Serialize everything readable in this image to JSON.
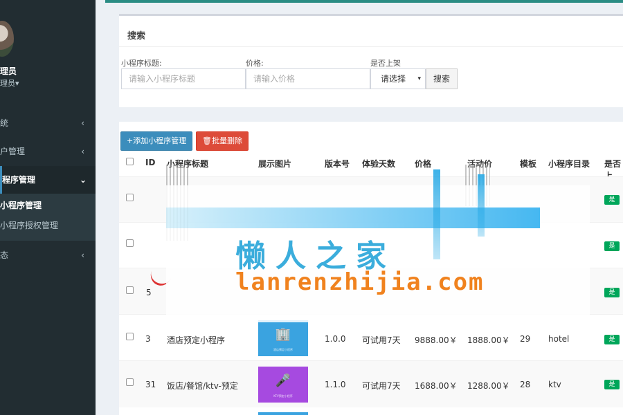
{
  "sidebar": {
    "user_name": "理员",
    "user_role": "理员",
    "role_caret": "▾",
    "menu": [
      {
        "label": "统",
        "chevron": "‹"
      },
      {
        "label": "户管理",
        "chevron": "‹"
      },
      {
        "label": "程序管理",
        "chevron": "⌄"
      },
      {
        "label": "态",
        "chevron": "‹"
      }
    ],
    "submenu": [
      {
        "label": "小程序管理"
      },
      {
        "label": "小程序授权管理"
      }
    ]
  },
  "search": {
    "title": "搜索",
    "title_label": "小程序标题:",
    "title_placeholder": "请输入小程序标题",
    "price_label": "价格:",
    "price_placeholder": "请输入价格",
    "status_label": "是否上架",
    "status_selected": "请选择",
    "status_caret": "▾",
    "search_button": "搜索"
  },
  "toolbar": {
    "add_icon": "+",
    "add_label": "添加小程序管理",
    "delete_icon": "🗑",
    "delete_label": "批量删除"
  },
  "table": {
    "headers": [
      "ID",
      "小程序标题",
      "展示图片",
      "版本号",
      "体验天数",
      "价格",
      "活动价",
      "模板",
      "小程序目录",
      "是否上"
    ],
    "rows": [
      {
        "id": "",
        "title": "",
        "version": "",
        "trial": "",
        "price": "",
        "sale_price": "",
        "template": "",
        "dir": "",
        "published": "是"
      },
      {
        "id": "",
        "title": "",
        "version": "",
        "trial": "",
        "price": "",
        "sale_price": "",
        "template": "",
        "dir": "",
        "published": "是"
      },
      {
        "id": "5",
        "title": "",
        "version": "",
        "trial": "",
        "price": "",
        "sale_price": "",
        "template": "",
        "dir": "",
        "published": "是"
      },
      {
        "id": "3",
        "title": "酒店预定小程序",
        "thumb_icon": "🏢",
        "thumb_caption": "酒店预定小程序",
        "version": "1.0.0",
        "trial": "可试用7天",
        "price": "9888.00￥",
        "sale_price": "1888.00￥",
        "template": "29",
        "dir": "hotel",
        "published": "是"
      },
      {
        "id": "31",
        "title": "饭店/餐馆/ktv-预定",
        "thumb_icon": "🎤",
        "thumb_caption": "KTV预定小程序",
        "version": "1.1.0",
        "trial": "可试用7天",
        "price": "1688.00￥",
        "sale_price": "1288.00￥",
        "template": "28",
        "dir": "ktv",
        "published": "是"
      }
    ]
  },
  "watermark": {
    "cn_text": "懒人之家",
    "url": "lanrenzhijia.com"
  },
  "colors": {
    "sidebar": "#222d32",
    "primary": "#3c8dbc",
    "danger": "#dd4b39",
    "success": "#00a65a",
    "watermark_blue": "#1a9fd6",
    "watermark_orange": "#f0821e"
  }
}
